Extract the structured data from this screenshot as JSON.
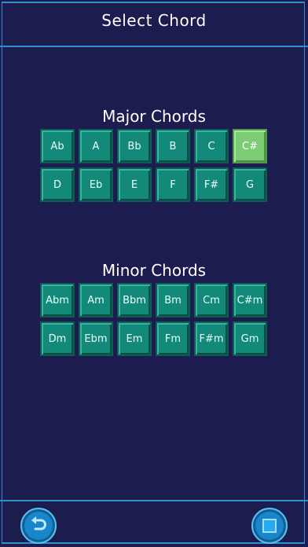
{
  "header": {
    "title": "Select Chord"
  },
  "major": {
    "title": "Major Chords",
    "chords": [
      "Ab",
      "A",
      "Bb",
      "B",
      "C",
      "C#",
      "D",
      "Eb",
      "E",
      "F",
      "F#",
      "G"
    ],
    "selected": "C#"
  },
  "minor": {
    "title": "Minor Chords",
    "chords": [
      "Abm",
      "Am",
      "Bbm",
      "Bm",
      "Cm",
      "C#m",
      "Dm",
      "Ebm",
      "Em",
      "Fm",
      "F#m",
      "Gm"
    ]
  },
  "footer": {
    "back_icon": "undo-arrow-icon",
    "stop_icon": "stop-square-icon"
  },
  "colors": {
    "background": "#1c1d4e",
    "accent_border": "#2f8ecf",
    "chord_button": "#13897a",
    "chord_selected": "#7ccc73",
    "round_button": "#1a86c9"
  }
}
